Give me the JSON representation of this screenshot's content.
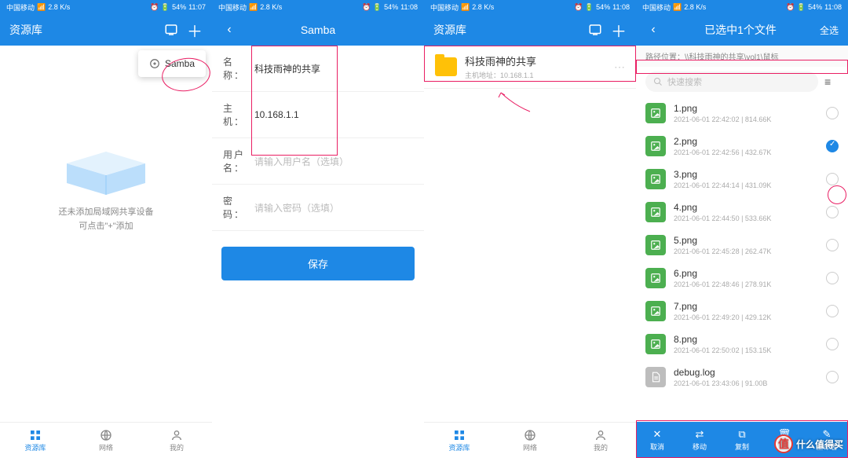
{
  "status": {
    "carrier": "中国移动",
    "net": "2.8 K/s",
    "icons": "ⓘ 📶 ⏰",
    "battery": "54%",
    "time1": "11:07",
    "time2": "11:08"
  },
  "screen1": {
    "title": "资源库",
    "dropdown_item": "Samba",
    "empty_line1": "还未添加局域网共享设备",
    "empty_line2": "可点击\"+\"添加",
    "tabs": {
      "lib": "资源库",
      "net": "网络",
      "mine": "我的"
    }
  },
  "screen2": {
    "title": "Samba",
    "labels": {
      "name": "名 称：",
      "host": "主 机：",
      "user": "用户名：",
      "pass": "密 码："
    },
    "values": {
      "name": "科技雨神的共享",
      "host": "10.168.1.1",
      "user_ph": "请输入用户名（选填）",
      "pass_ph": "请输入密码（选填）"
    },
    "save": "保存"
  },
  "screen3": {
    "title": "资源库",
    "share": {
      "name": "科技雨神的共享",
      "sub": "主机地址：10.168.1.1"
    },
    "tabs": {
      "lib": "资源库",
      "net": "网络",
      "mine": "我的"
    }
  },
  "screen4": {
    "title": "已选中1个文件",
    "select_all": "全选",
    "path_label": "路径位置：",
    "path": "\\\\科技雨神的共享\\vol1\\鼠标",
    "search_ph": "快速搜索",
    "files": [
      {
        "name": "1.png",
        "meta": "2021-06-01 22:42:02  |  814.66K",
        "type": "img",
        "checked": false
      },
      {
        "name": "2.png",
        "meta": "2021-06-01 22:42:56  |  432.67K",
        "type": "img",
        "checked": true
      },
      {
        "name": "3.png",
        "meta": "2021-06-01 22:44:14  |  431.09K",
        "type": "img",
        "checked": false
      },
      {
        "name": "4.png",
        "meta": "2021-06-01 22:44:50  |  533.66K",
        "type": "img",
        "checked": false
      },
      {
        "name": "5.png",
        "meta": "2021-06-01 22:45:28  |  262.47K",
        "type": "img",
        "checked": false
      },
      {
        "name": "6.png",
        "meta": "2021-06-01 22:48:46  |  278.91K",
        "type": "img",
        "checked": false
      },
      {
        "name": "7.png",
        "meta": "2021-06-01 22:49:20  |  429.12K",
        "type": "img",
        "checked": false
      },
      {
        "name": "8.png",
        "meta": "2021-06-01 22:50:02  |  153.15K",
        "type": "img",
        "checked": false
      },
      {
        "name": "debug.log",
        "meta": "2021-06-01 23:43:06  |  91.00B",
        "type": "txt",
        "checked": false
      }
    ],
    "actions": {
      "cancel": "取消",
      "move": "移动",
      "copy": "复制",
      "delete": "删除",
      "rename": "重命名"
    }
  },
  "watermark": "什么值得买"
}
